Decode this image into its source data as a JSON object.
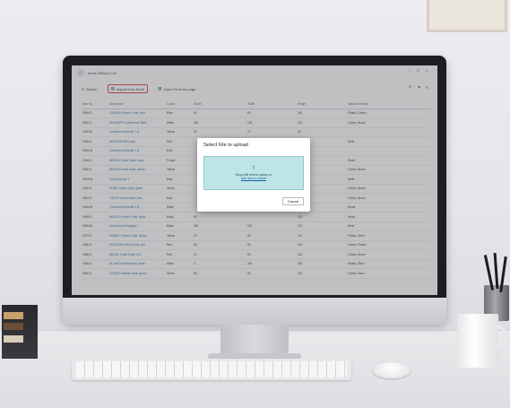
{
  "page": {
    "title": "Items Without Cat",
    "title_icons": [
      "bookmark-icon",
      "share-icon",
      "expand-icon"
    ]
  },
  "toolbar": {
    "search_label": "Search",
    "import_label": "Import from Excel",
    "open_label": "Open Error list page",
    "right_icons": [
      "share-icon",
      "filter-icon",
      "columns-icon"
    ]
  },
  "grid": {
    "columns": [
      "Item No.",
      "Description",
      "Colour",
      "Depth",
      "Width",
      "Height",
      "Material Descrip"
    ],
    "rows": [
      [
        "1896-S",
        "LONDON Swivel Chair, blue",
        "Blue",
        "60",
        "60",
        "140",
        "Plastic, Cotton"
      ],
      [
        "1900-S",
        "ANTWERP Conference Table",
        "White",
        "200",
        "100",
        "120",
        "Cotton, Wood"
      ],
      [
        "1920-W",
        "Conference Bundle 1-6",
        "Yellow",
        "50",
        "70",
        "90",
        ""
      ],
      [
        "1928-S",
        "AMSTERDAM Lamp",
        "Red",
        "",
        "",
        "80",
        "Steel"
      ],
      [
        "1929-W",
        "Conference Bundle 1-8",
        "Blue",
        "",
        "",
        "100",
        ""
      ],
      [
        "1936-S",
        "BERLIN Guest Chair, black",
        "Purple",
        "",
        "",
        "180",
        "Wood"
      ],
      [
        "1960-S",
        "BERLIN Guest Chair, yellow",
        "Yellow",
        "",
        "",
        "110",
        "Cotton, Wood"
      ],
      [
        "1953-W",
        "Guest Section 1",
        "Blue",
        "",
        "",
        "120",
        "Steel"
      ],
      [
        "1960-S",
        "ROME Guest Chair, green",
        "Green",
        "",
        "",
        "110",
        "Cotton, Wood"
      ],
      [
        "1964-S",
        "TOKYO Guest Chair, blue",
        "Blue",
        "",
        "",
        "120",
        "Cotton, Wood"
      ],
      [
        "1965-W",
        "Conference Bundle 2-8",
        "Black",
        "",
        "",
        "120",
        "Wood"
      ],
      [
        "1968-S",
        "MEXICO Swivel Chair, black",
        "Black",
        "50",
        "",
        "110",
        "Wood"
      ],
      [
        "1969-W",
        "Conference Package 1",
        "Black",
        "200",
        "200",
        "120",
        "Steel"
      ],
      [
        "1972-S",
        "MUNICH Swivel Chair, yellow",
        "Yellow",
        "70",
        "90",
        "110",
        "Plastic, Steel"
      ],
      [
        "1980-S",
        "MOSCOW Swivel Chair, red",
        "Red",
        "80",
        "90",
        "140",
        "Cotton, Plastic"
      ],
      [
        "1988-S",
        "SEOUL Guest Chair, red",
        "Red",
        "70",
        "90",
        "120",
        "Cotton, Wood"
      ],
      [
        "1996-S",
        "ATLANTA Whiteboard, base",
        "White",
        "2",
        "200",
        "220",
        "Plastic, Steel"
      ],
      [
        "2000-S",
        "SYDNEY Swivel Chair, green",
        "Green",
        "80",
        "90",
        "110",
        "Cotton, Steel"
      ]
    ]
  },
  "dialog": {
    "title": "Select File to upload",
    "drop_text": "Drop a file here to upload, or",
    "link_text": "click here to browse",
    "cancel_label": "Cancel"
  },
  "colors": {
    "highlight": "#d93a3a",
    "dropzone": "#bfe4e6",
    "link": "#1b5fa0"
  }
}
